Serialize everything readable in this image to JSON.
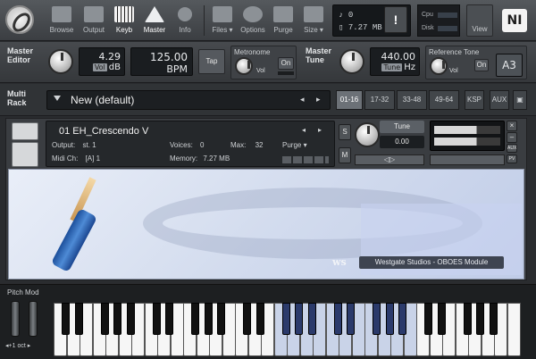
{
  "toolbar": {
    "buttons": [
      {
        "label": "Browse",
        "icon": "folder-icon",
        "active": false
      },
      {
        "label": "Output",
        "icon": "mixer-icon",
        "active": false
      },
      {
        "label": "Keyb",
        "icon": "keyboard-icon",
        "active": true
      },
      {
        "label": "Master",
        "icon": "metronome-icon",
        "active": true
      },
      {
        "label": "Info",
        "icon": "info-icon",
        "active": false
      }
    ],
    "menus": [
      {
        "label": "Files ▾",
        "icon": "save-icon"
      },
      {
        "label": "Options",
        "icon": "gear-icon"
      },
      {
        "label": "Purge",
        "icon": "purge-icon"
      },
      {
        "label": "Size ▾",
        "icon": "size-icon"
      }
    ],
    "status": {
      "voices": "0",
      "memory": "7.27 MB"
    },
    "warning_label": "!",
    "cpu_label": "Cpu",
    "disk_label": "Disk",
    "view_label": "View",
    "ni_logo": "NI"
  },
  "master": {
    "editor_label": "Master",
    "editor_label2": "Editor",
    "vol_value": "4.29",
    "vol_unit": "Vol",
    "vol_db": "dB",
    "tempo_value": "125.00",
    "tempo_unit": "BPM",
    "tap_label": "Tap",
    "metronome_label": "Metronome",
    "metronome_on": "On",
    "metronome_vol": "Vol",
    "tune_label": "Master",
    "tune_label2": "Tune",
    "tune_value": "440.00",
    "tune_unit": "Tune",
    "tune_hz": "Hz",
    "reference_label": "Reference Tone",
    "reference_vol": "Vol",
    "reference_on": "On",
    "reference_note": "A3"
  },
  "rack": {
    "label": "Multi",
    "label2": "Rack",
    "name": "New (default)",
    "pages": [
      "01-16",
      "17-32",
      "33-48",
      "49-64"
    ],
    "active_page": "01-16",
    "ksp_label": "KSP",
    "aux_label": "AUX"
  },
  "instrument": {
    "name": "01 EH_Crescendo V",
    "output_label": "Output:",
    "output_value": "st. 1",
    "voices_label": "Voices:",
    "voices_value": "0",
    "max_label": "Max:",
    "max_value": "32",
    "purge_label": "Purge",
    "midi_label": "Midi Ch:",
    "midi_value": "[A] 1",
    "memory_label": "Memory:",
    "memory_value": "7.27 MB",
    "solo_label": "S",
    "mute_label": "M",
    "tune_label": "Tune",
    "tune_value": "0.00",
    "pan_label": "◁▷",
    "aux_labels": [
      "AUX",
      "PV"
    ],
    "brand": "Westgate Studios - OBOES Module",
    "brand_logo": "ws"
  },
  "keyboard": {
    "pitch_label": "Pitch Mod",
    "octave_label": "◂+1 oct ▸"
  }
}
